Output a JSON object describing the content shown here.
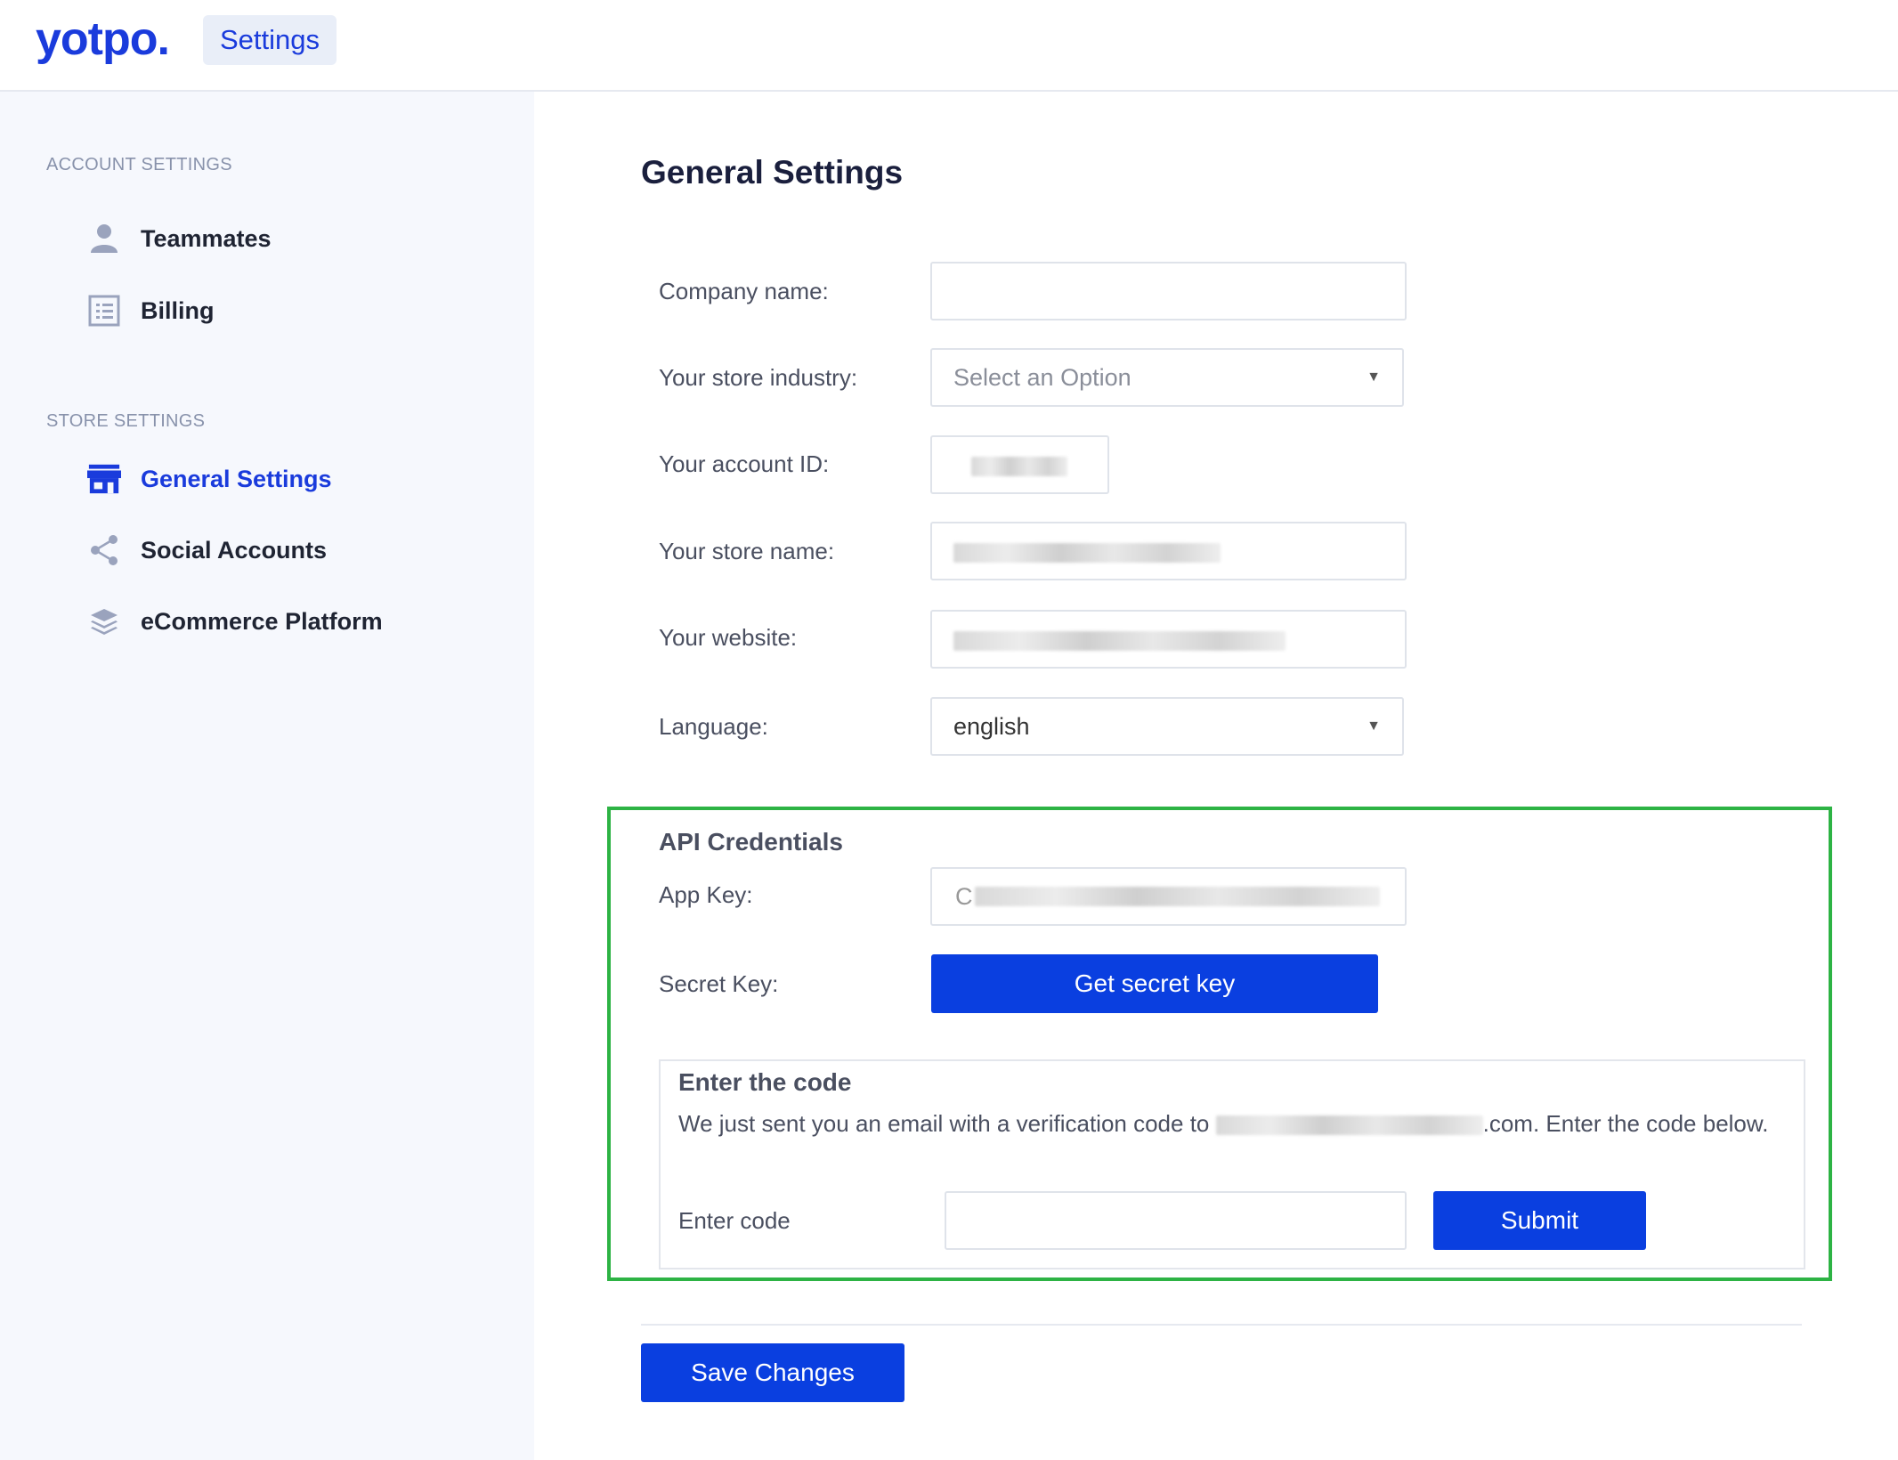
{
  "header": {
    "logo": "yotpo.",
    "section_label": "Settings"
  },
  "sidebar": {
    "account_title": "ACCOUNT SETTINGS",
    "account_items": [
      {
        "label": "Teammates",
        "icon": "person-icon"
      },
      {
        "label": "Billing",
        "icon": "list-icon"
      }
    ],
    "store_title": "STORE SETTINGS",
    "store_items": [
      {
        "label": "General Settings",
        "icon": "store-icon",
        "active": true
      },
      {
        "label": "Social Accounts",
        "icon": "share-icon"
      },
      {
        "label": "eCommerce Platform",
        "icon": "layers-icon"
      }
    ]
  },
  "main": {
    "title": "General Settings",
    "fields": {
      "company_name": {
        "label": "Company name:",
        "value": ""
      },
      "industry": {
        "label": "Your store industry:",
        "placeholder": "Select an Option"
      },
      "account_id": {
        "label": "Your account ID:"
      },
      "store_name": {
        "label": "Your store name:"
      },
      "website": {
        "label": "Your website:"
      },
      "language": {
        "label": "Language:",
        "value": "english"
      }
    },
    "api": {
      "title": "API Credentials",
      "app_key_label": "App Key:",
      "app_key_prefix": "C",
      "secret_key_label": "Secret Key:",
      "secret_button": "Get secret key",
      "code": {
        "title": "Enter the code",
        "desc_prefix": "We just sent you an email with a verification code to",
        "desc_suffix": ".com. Enter the code below.",
        "input_label": "Enter code",
        "submit": "Submit"
      }
    },
    "save_button": "Save Changes"
  },
  "colors": {
    "brand": "#1a3bdc",
    "button": "#0a3fe0",
    "highlight_border": "#2db344",
    "sidebar_bg": "#f6f8fd"
  }
}
